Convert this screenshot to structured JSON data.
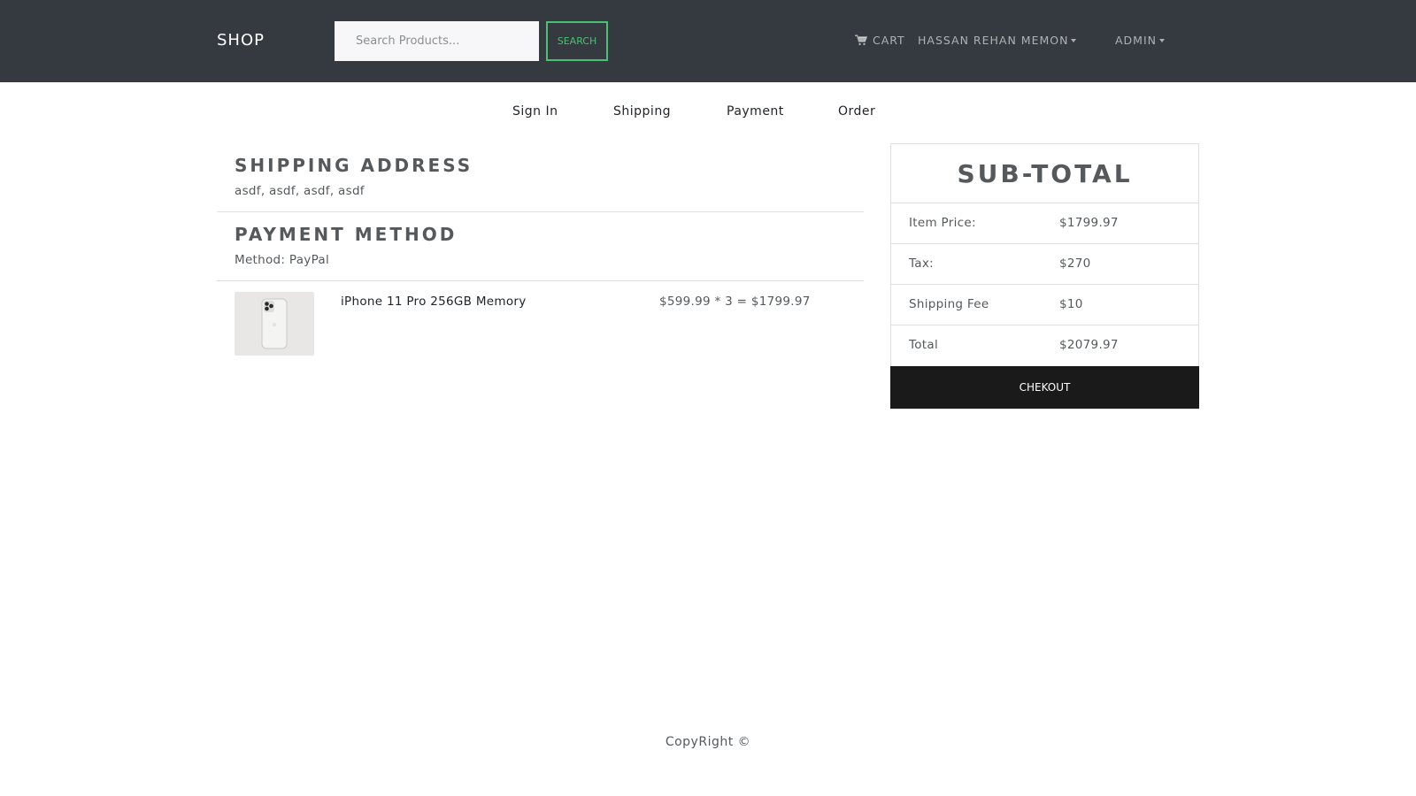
{
  "navbar": {
    "brand": "SHOP",
    "search": {
      "placeholder": "Search Products...",
      "button_label": "SEARCH"
    },
    "cart_label": "CART",
    "user_label": "HASSAN REHAN MEMON",
    "admin_label": "ADMIN"
  },
  "steps": [
    "Sign In",
    "Shipping",
    "Payment",
    "Order"
  ],
  "shipping": {
    "heading": "SHIPPING ADDRESS",
    "address": "asdf, asdf, asdf, asdf"
  },
  "payment": {
    "heading": "PAYMENT METHOD",
    "method": "Method: PayPal"
  },
  "items": [
    {
      "name": "iPhone 11 Pro 256GB Memory",
      "price_line": "$599.99 * 3 = $1799.97",
      "image_icon": "phone-image"
    }
  ],
  "summary": {
    "title": "SUB-TOTAL",
    "rows": [
      {
        "label": "Item Price:",
        "value": "$1799.97"
      },
      {
        "label": "Tax:",
        "value": "$270"
      },
      {
        "label": "Shipping Fee",
        "value": "$10"
      },
      {
        "label": "Total",
        "value": "$2079.97"
      }
    ],
    "button_label": "CHEKOUT"
  },
  "footer": {
    "text": "CopyRight ©"
  },
  "colors": {
    "navbar": "#343a40",
    "accent": "#4bbf73",
    "button_dark": "#1a1a1a"
  }
}
